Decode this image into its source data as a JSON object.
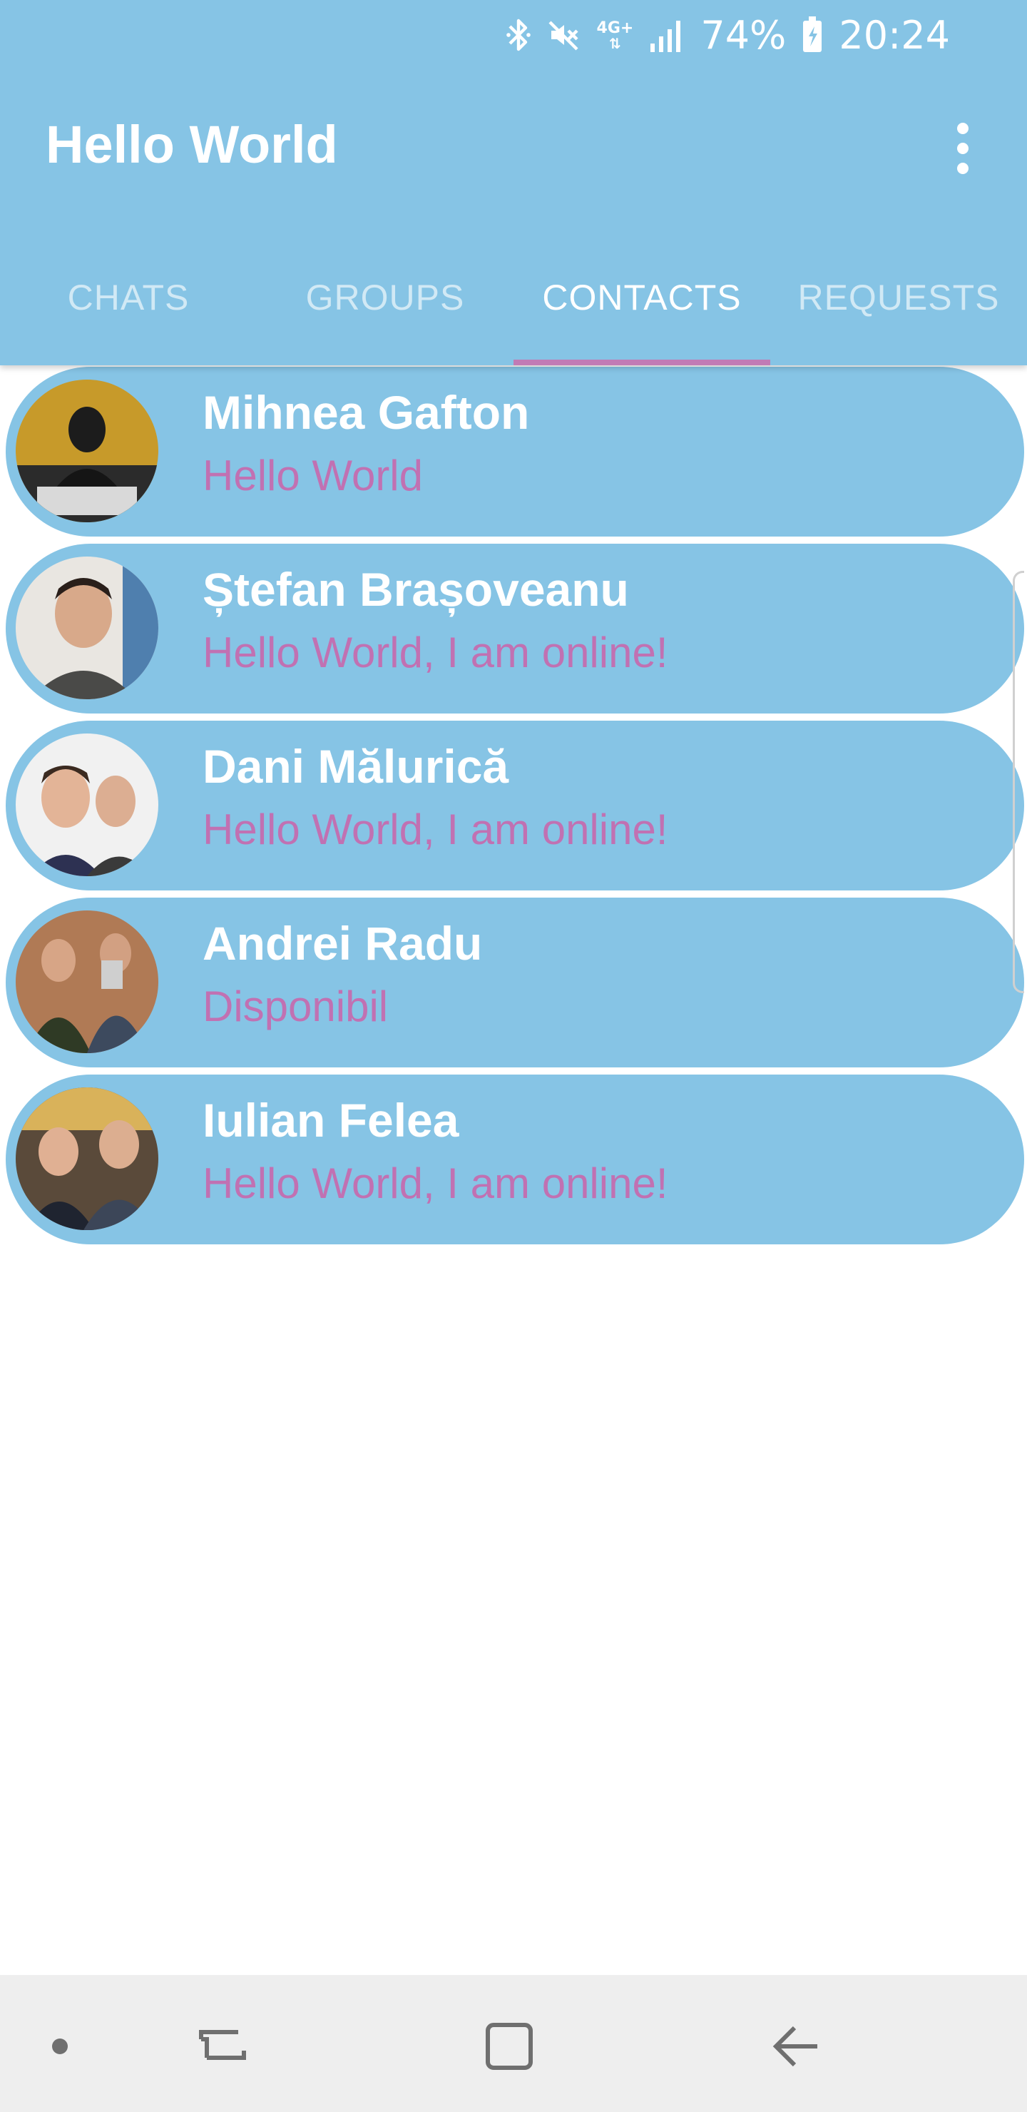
{
  "status_bar": {
    "icons": [
      "bluetooth-icon",
      "mute-icon",
      "4g-plus-icon",
      "signal-icon",
      "battery-charging-icon"
    ],
    "network": "4G+",
    "battery": "74%",
    "time": "20:24"
  },
  "app_bar": {
    "title": "Hello World",
    "menu_icon": "more-vertical-icon"
  },
  "tabs": [
    {
      "label": "CHATS",
      "active": false
    },
    {
      "label": "GROUPS",
      "active": false
    },
    {
      "label": "CONTACTS",
      "active": true
    },
    {
      "label": "REQUESTS",
      "active": false
    }
  ],
  "contacts": [
    {
      "name": "Mihnea Gafton",
      "status": "Hello World"
    },
    {
      "name": "Ștefan Brașoveanu",
      "status": "Hello World, I am online!"
    },
    {
      "name": "Dani Mălurică",
      "status": "Hello World, I am online!"
    },
    {
      "name": "Andrei Radu",
      "status": "Disponibil"
    },
    {
      "name": "Iulian Felea",
      "status": "Hello World, I am online!"
    }
  ],
  "nav_bar": {
    "items": [
      "dot-icon",
      "recent-apps-icon",
      "home-icon",
      "back-icon"
    ]
  },
  "colors": {
    "primary": "#86c4e5",
    "accent": "#c17bb5",
    "status_text": "#c171b2",
    "nav_bg": "#eeeeee"
  }
}
